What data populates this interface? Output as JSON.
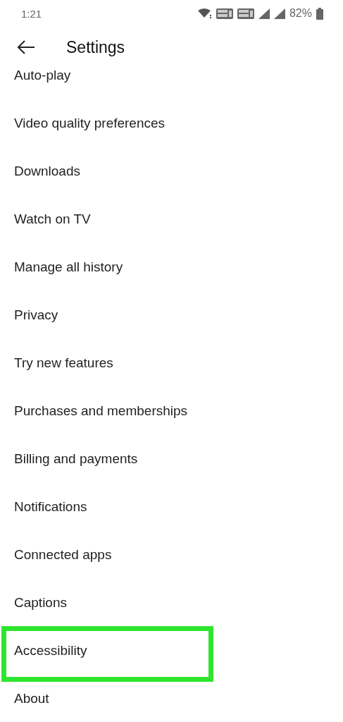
{
  "status_bar": {
    "time": "1:21",
    "battery": "82%"
  },
  "header": {
    "title": "Settings"
  },
  "items": [
    {
      "label": "Auto-play",
      "highlighted": false
    },
    {
      "label": "Video quality preferences",
      "highlighted": false
    },
    {
      "label": "Downloads",
      "highlighted": false
    },
    {
      "label": "Watch on TV",
      "highlighted": false
    },
    {
      "label": "Manage all history",
      "highlighted": false
    },
    {
      "label": "Privacy",
      "highlighted": false
    },
    {
      "label": "Try new features",
      "highlighted": false
    },
    {
      "label": "Purchases and memberships",
      "highlighted": false
    },
    {
      "label": "Billing and payments",
      "highlighted": false
    },
    {
      "label": "Notifications",
      "highlighted": false
    },
    {
      "label": "Connected apps",
      "highlighted": false
    },
    {
      "label": "Captions",
      "highlighted": false
    },
    {
      "label": "Accessibility",
      "highlighted": true
    },
    {
      "label": "About",
      "highlighted": false
    }
  ]
}
